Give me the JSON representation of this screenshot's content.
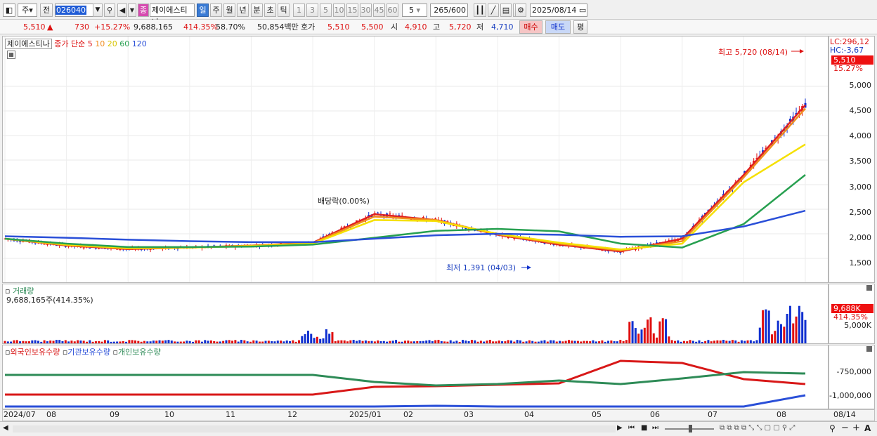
{
  "toolbar": {
    "period_type": "주",
    "prev_label": "전",
    "code": "026040",
    "market_badge": "종",
    "stock_name": "제이에스티나",
    "timeframes": [
      "일",
      "주",
      "월",
      "년",
      "분",
      "초",
      "틱"
    ],
    "active_timeframe": "일",
    "intervals": [
      "1",
      "3",
      "5",
      "10",
      "15",
      "30",
      "45",
      "60"
    ],
    "interval_value": "5",
    "count": "265",
    "max_count": "/600",
    "date": "2025/08/14"
  },
  "quote": {
    "price": "5,510",
    "change": "730",
    "change_pct": "+15.27%",
    "volume": "9,688,165",
    "volume_pct": "414.35%",
    "turnover_pct": "58.70%",
    "amount": "50,854백만",
    "hoga_label": "호가",
    "ask": "5,510",
    "bid": "5,500",
    "open_label": "시",
    "open": "4,910",
    "high_label": "고",
    "high": "5,720",
    "low_label": "저",
    "low": "4,710",
    "buy_label": "매수",
    "sell_label": "매도",
    "eval_label": "평"
  },
  "price_panel": {
    "name": "제이에스티나",
    "ma_label": "종가 단순",
    "ma_periods": [
      "5",
      "10",
      "20",
      "60",
      "120"
    ],
    "ma_colors": [
      "#e02020",
      "#f08c1e",
      "#f5e000",
      "#27a050",
      "#2a4fd8"
    ],
    "lc": "LC:296,12",
    "hc": "HC:-3,67",
    "last_price": "5,510",
    "last_pct": "15.27%",
    "high_annot": "최고 5,720 (08/14)",
    "low_annot": "최저 1,391 (04/03)",
    "dividend_annot": "배당락(0.00%)",
    "yticks": [
      "5,000",
      "4,500",
      "4,000",
      "3,500",
      "3,000",
      "2,500",
      "2,000",
      "1,500"
    ]
  },
  "volume_panel": {
    "title": "거래량",
    "value": "9,688,165주(414.35%)",
    "last_tag": "9,688K",
    "last_pct": "414.35%",
    "ytick": "5,000K"
  },
  "holding_panel": {
    "series": [
      "외국인보유수량",
      "기관보유수량",
      "개인보유수량"
    ],
    "colors": [
      "#d81818",
      "#2a4fd8",
      "#2e8b57"
    ],
    "yticks": [
      "-750,000",
      "-1,000,000"
    ]
  },
  "xaxis": {
    "labels": [
      "2024/07",
      "08",
      "09",
      "10",
      "11",
      "12",
      "2025/01",
      "02",
      "03",
      "04",
      "05",
      "06",
      "07",
      "08"
    ],
    "right_label": "08/14"
  },
  "chart_data": {
    "type": "line",
    "title": "제이에스티나",
    "x": [
      "2024/07",
      "08",
      "09",
      "10",
      "11",
      "12",
      "2025/01",
      "02",
      "03",
      "04",
      "05",
      "06",
      "07",
      "08/14"
    ],
    "ylim": [
      1100,
      5900
    ],
    "series": [
      {
        "name": "5",
        "values": [
          1900,
          1760,
          1690,
          1720,
          1760,
          1820,
          2400,
          2280,
          1980,
          1780,
          1640,
          1900,
          3200,
          4620
        ]
      },
      {
        "name": "10",
        "values": [
          1900,
          1770,
          1700,
          1720,
          1760,
          1810,
          2350,
          2280,
          1990,
          1800,
          1660,
          1850,
          3150,
          4550
        ]
      },
      {
        "name": "20",
        "values": [
          1900,
          1780,
          1710,
          1720,
          1750,
          1800,
          2280,
          2260,
          2000,
          1820,
          1680,
          1800,
          3050,
          3820
        ]
      },
      {
        "name": "60",
        "values": [
          1900,
          1800,
          1730,
          1730,
          1740,
          1780,
          1920,
          2060,
          2100,
          2050,
          1800,
          1720,
          2200,
          3200
        ]
      },
      {
        "name": "120",
        "values": [
          1950,
          1920,
          1880,
          1850,
          1830,
          1830,
          1900,
          1970,
          2000,
          1980,
          1940,
          1950,
          2150,
          2470
        ]
      }
    ],
    "annotations": [
      "최고 5,720 (08/14)",
      "최저 1,391 (04/03)",
      "배당락(0.00%)"
    ]
  }
}
